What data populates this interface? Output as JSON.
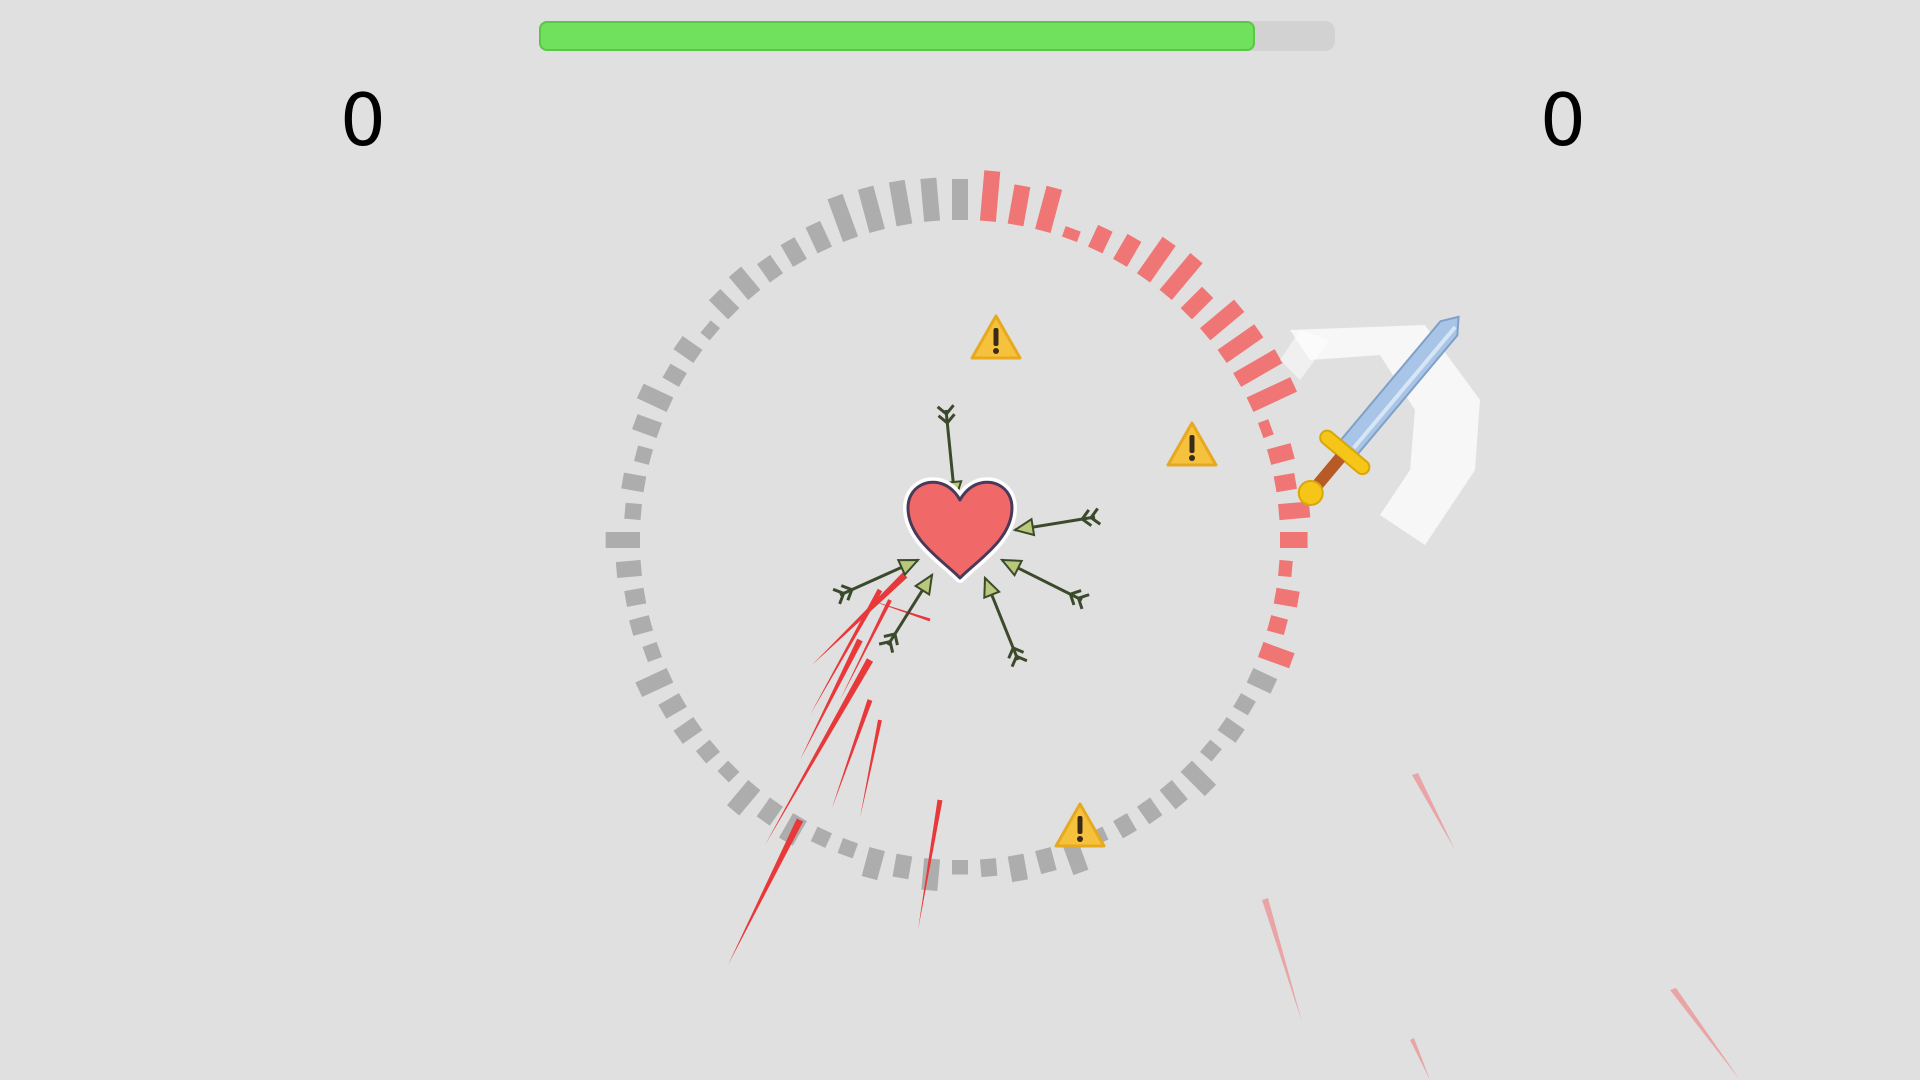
{
  "hud": {
    "health": 0.9,
    "health_color": "#6fe15c",
    "score_left": "0",
    "score_right": "0"
  },
  "arena": {
    "danger_color": "#f07575",
    "neutral_color": "#adadad",
    "blood_color": "#e8383a",
    "warning_color": "#f6c23e"
  },
  "entities": {
    "player": "heart",
    "weapon": "sword",
    "arrows_stuck": 6,
    "warnings": 3
  }
}
